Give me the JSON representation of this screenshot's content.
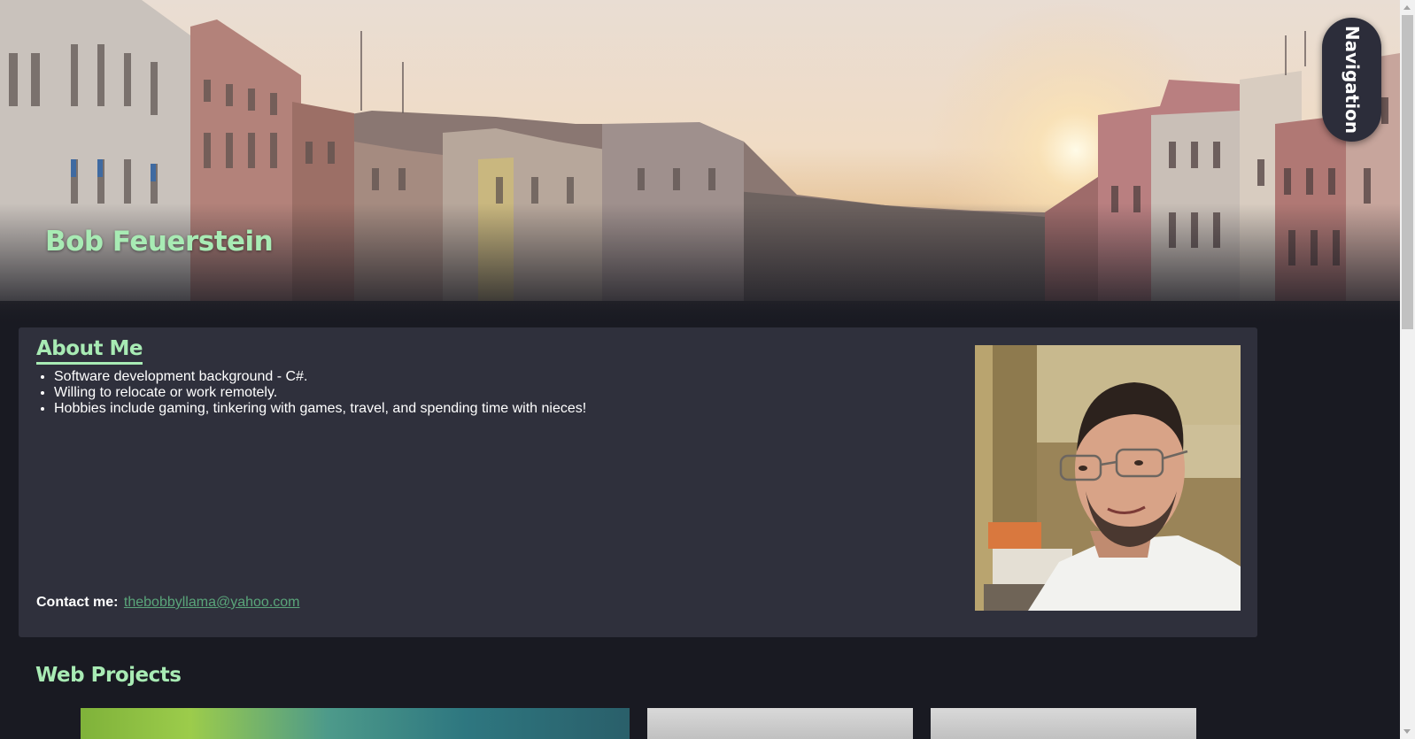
{
  "hero": {
    "title": "Bob Feuerstein",
    "background_image": "venice-grand-canal-sunset"
  },
  "navigation": {
    "label": "Navigation"
  },
  "about": {
    "heading": "About Me",
    "items": [
      "Software development background - C#.",
      "Willing to relocate or work remotely.",
      "Hobbies include gaming, tinkering with games, travel, and spending time with nieces!"
    ],
    "contact_label": "Contact me:",
    "contact_email": "thebobbyllama@yahoo.com",
    "portrait_image": "portrait-photo"
  },
  "projects": {
    "heading": "Web Projects"
  },
  "colors": {
    "page_background": "#191a22",
    "card_background": "#2f303c",
    "accent_green": "#a8ebb4",
    "link_green": "#5aa57a",
    "nav_pill": "#2c2d3a"
  }
}
